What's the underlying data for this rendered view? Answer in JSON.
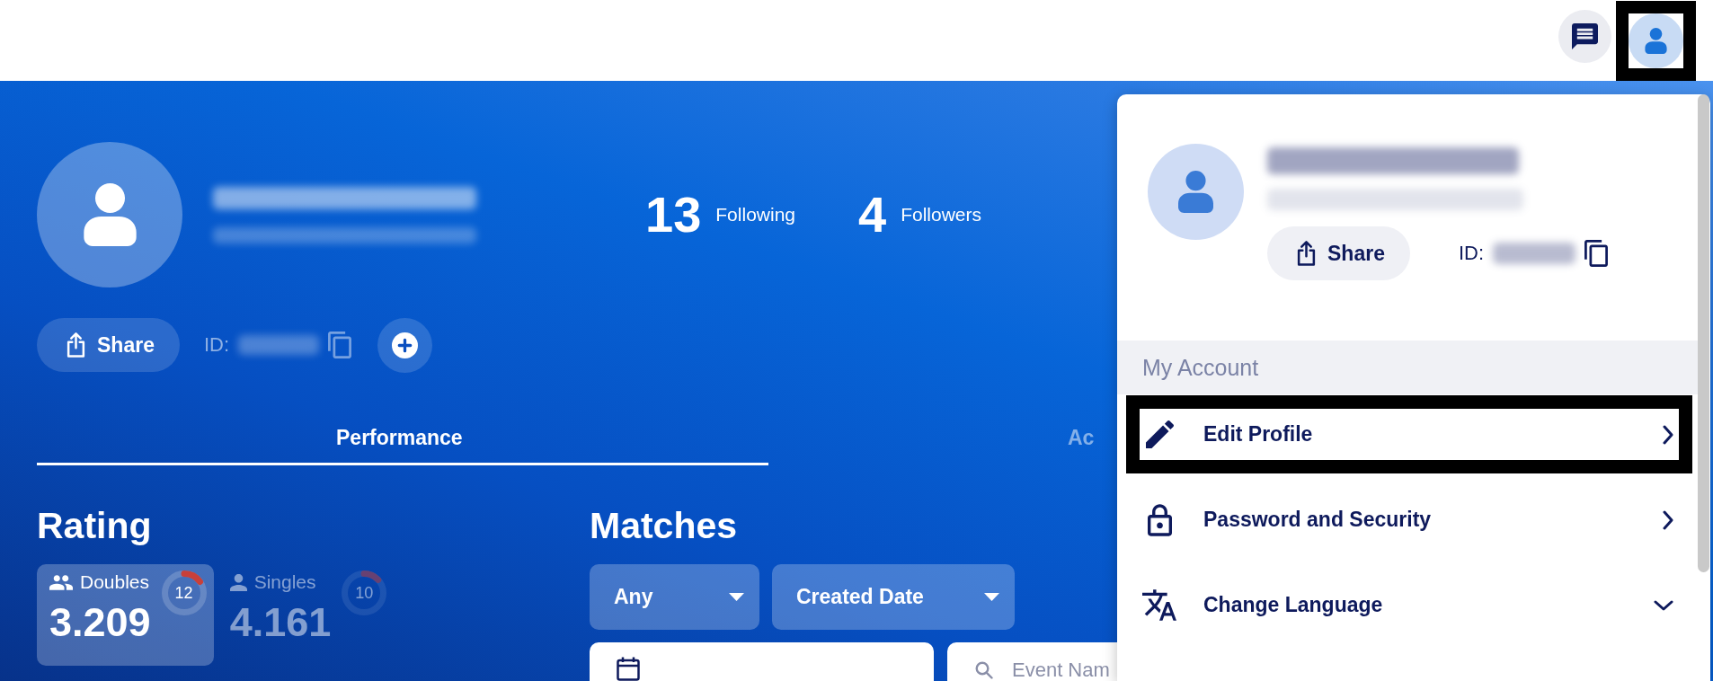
{
  "top_bar": {
    "buttons": [
      {
        "kind": "chat",
        "highlighted": false
      },
      {
        "kind": "profile",
        "highlighted": true
      }
    ]
  },
  "profile": {
    "stats": [
      {
        "value": "13",
        "label": "Following"
      },
      {
        "value": "4",
        "label": "Followers"
      }
    ],
    "share_button": "Share",
    "id_label": "ID:"
  },
  "tabs": [
    {
      "label": "Performance",
      "selected": true
    },
    {
      "label": "Ac",
      "selected": false
    }
  ],
  "rating": {
    "title": "Rating",
    "cards": [
      {
        "kind": "doubles",
        "label": "Doubles",
        "value": "3.209",
        "count": "12",
        "level": 0.15,
        "selected": true
      },
      {
        "kind": "singles",
        "label": "Singles",
        "value": "4.161",
        "count": "10",
        "level": 0.13,
        "selected": false
      }
    ]
  },
  "matches": {
    "title": "Matches",
    "filters": [
      "Any",
      "Created Date"
    ],
    "search": {
      "placeholder": "Event Nam"
    }
  },
  "account_menu": {
    "share_button": "Share",
    "id_label": "ID:",
    "section_title": "My Account",
    "items": [
      {
        "kind": "edit",
        "label": "Edit Profile",
        "highlighted": true
      },
      {
        "kind": "security",
        "label": "Password and Security",
        "highlighted": false
      },
      {
        "kind": "language",
        "label": "Change Language",
        "highlighted": false,
        "expanded": false
      }
    ]
  }
}
